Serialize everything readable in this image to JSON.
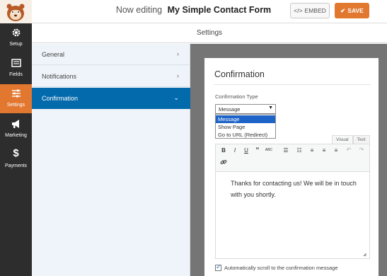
{
  "header": {
    "editing_prefix": "Now editing",
    "form_name": "My Simple Contact Form",
    "embed_label": "EMBED",
    "save_label": "SAVE",
    "accent_color": "#e27730"
  },
  "leftnav": {
    "items": [
      {
        "label": "Setup",
        "icon": "gear-icon"
      },
      {
        "label": "Fields",
        "icon": "fields-icon"
      },
      {
        "label": "Settings",
        "icon": "sliders-icon",
        "active": true
      },
      {
        "label": "Marketing",
        "icon": "megaphone-icon"
      },
      {
        "label": "Payments",
        "icon": "dollar-icon"
      }
    ]
  },
  "settings_header": "Settings",
  "subnav": {
    "items": [
      {
        "label": "General",
        "chevron": "›"
      },
      {
        "label": "Notifications",
        "chevron": "›"
      },
      {
        "label": "Confirmation",
        "chevron": "⌄",
        "active": true
      }
    ]
  },
  "confirmation": {
    "title": "Confirmation",
    "type_label": "Confirmation Type",
    "select_value": "Message",
    "options": [
      "Message",
      "Show Page",
      "Go to URL (Redirect)"
    ],
    "tabs": [
      "Visual",
      "Text"
    ],
    "message_text": "Thanks for contacting us! We will be in touch with you shortly.",
    "autoscroll_label": "Automatically scroll to the confirmation message",
    "autoscroll_checked": true
  }
}
